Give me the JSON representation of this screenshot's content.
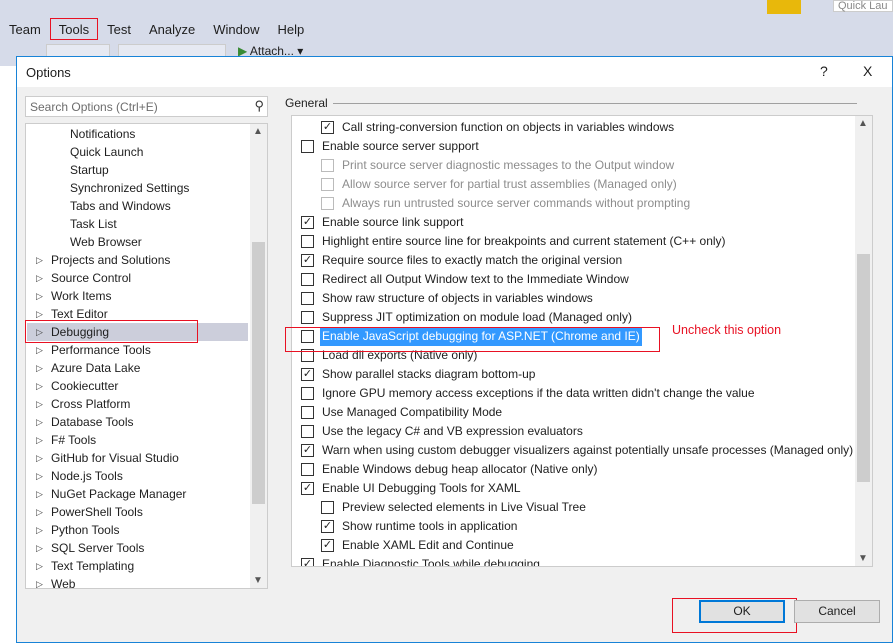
{
  "menubar": [
    "Team",
    "Tools",
    "Test",
    "Analyze",
    "Window",
    "Help"
  ],
  "toolbar": {
    "attach_label": "Attach..."
  },
  "quick_launch": {
    "placeholder": "Quick Lau"
  },
  "dialog": {
    "title": "Options",
    "help": "?",
    "close": "X",
    "search_placeholder": "Search Options (Ctrl+E)",
    "tree": [
      {
        "label": "Notifications",
        "level": 1
      },
      {
        "label": "Quick Launch",
        "level": 1
      },
      {
        "label": "Startup",
        "level": 1
      },
      {
        "label": "Synchronized Settings",
        "level": 1
      },
      {
        "label": "Tabs and Windows",
        "level": 1
      },
      {
        "label": "Task List",
        "level": 1
      },
      {
        "label": "Web Browser",
        "level": 1
      },
      {
        "label": "Projects and Solutions",
        "level": 0
      },
      {
        "label": "Source Control",
        "level": 0
      },
      {
        "label": "Work Items",
        "level": 0
      },
      {
        "label": "Text Editor",
        "level": 0
      },
      {
        "label": "Debugging",
        "level": 0,
        "selected": true
      },
      {
        "label": "Performance Tools",
        "level": 0
      },
      {
        "label": "Azure Data Lake",
        "level": 0
      },
      {
        "label": "Cookiecutter",
        "level": 0
      },
      {
        "label": "Cross Platform",
        "level": 0
      },
      {
        "label": "Database Tools",
        "level": 0
      },
      {
        "label": "F# Tools",
        "level": 0
      },
      {
        "label": "GitHub for Visual Studio",
        "level": 0
      },
      {
        "label": "Node.js Tools",
        "level": 0
      },
      {
        "label": "NuGet Package Manager",
        "level": 0
      },
      {
        "label": "PowerShell Tools",
        "level": 0
      },
      {
        "label": "Python Tools",
        "level": 0
      },
      {
        "label": "SQL Server Tools",
        "level": 0
      },
      {
        "label": "Text Templating",
        "level": 0
      },
      {
        "label": "Web",
        "level": 0
      }
    ],
    "section": "General",
    "options": [
      {
        "label": "Call string-conversion function on objects in variables windows",
        "checked": true,
        "indent": 1
      },
      {
        "label": "Enable source server support",
        "checked": false,
        "indent": 0
      },
      {
        "label": "Print source server diagnostic messages to the Output window",
        "checked": false,
        "indent": 1,
        "disabled": true
      },
      {
        "label": "Allow source server for partial trust assemblies (Managed only)",
        "checked": false,
        "indent": 1,
        "disabled": true
      },
      {
        "label": "Always run untrusted source server commands without prompting",
        "checked": false,
        "indent": 1,
        "disabled": true
      },
      {
        "label": "Enable source link support",
        "checked": true,
        "indent": 0
      },
      {
        "label": "Highlight entire source line for breakpoints and current statement (C++ only)",
        "checked": false,
        "indent": 0
      },
      {
        "label": "Require source files to exactly match the original version",
        "checked": true,
        "indent": 0
      },
      {
        "label": "Redirect all Output Window text to the Immediate Window",
        "checked": false,
        "indent": 0
      },
      {
        "label": "Show raw structure of objects in variables windows",
        "checked": false,
        "indent": 0
      },
      {
        "label": "Suppress JIT optimization on module load (Managed only)",
        "checked": false,
        "indent": 0
      },
      {
        "label": "Enable JavaScript debugging for ASP.NET (Chrome and IE)",
        "checked": false,
        "indent": 0,
        "selected": true
      },
      {
        "label": "Load dll exports (Native only)",
        "checked": false,
        "indent": 0
      },
      {
        "label": "Show parallel stacks diagram bottom-up",
        "checked": true,
        "indent": 0
      },
      {
        "label": "Ignore GPU memory access exceptions if the data written didn't change the value",
        "checked": false,
        "indent": 0
      },
      {
        "label": "Use Managed Compatibility Mode",
        "checked": false,
        "indent": 0
      },
      {
        "label": "Use the legacy C# and VB expression evaluators",
        "checked": false,
        "indent": 0
      },
      {
        "label": "Warn when using custom debugger visualizers against potentially unsafe processes (Managed only)",
        "checked": true,
        "indent": 0
      },
      {
        "label": "Enable Windows debug heap allocator (Native only)",
        "checked": false,
        "indent": 0
      },
      {
        "label": "Enable UI Debugging Tools for XAML",
        "checked": true,
        "indent": 0
      },
      {
        "label": "Preview selected elements in Live Visual Tree",
        "checked": false,
        "indent": 1
      },
      {
        "label": "Show runtime tools in application",
        "checked": true,
        "indent": 1
      },
      {
        "label": "Enable XAML Edit and Continue",
        "checked": true,
        "indent": 1
      },
      {
        "label": "Enable Diagnostic Tools while debugging",
        "checked": true,
        "indent": 0
      }
    ],
    "annotation": "Uncheck this option",
    "ok": "OK",
    "cancel": "Cancel"
  },
  "colors": {
    "highlight": "#e81123",
    "selection": "#3399ff",
    "accent": "#0078d7"
  }
}
